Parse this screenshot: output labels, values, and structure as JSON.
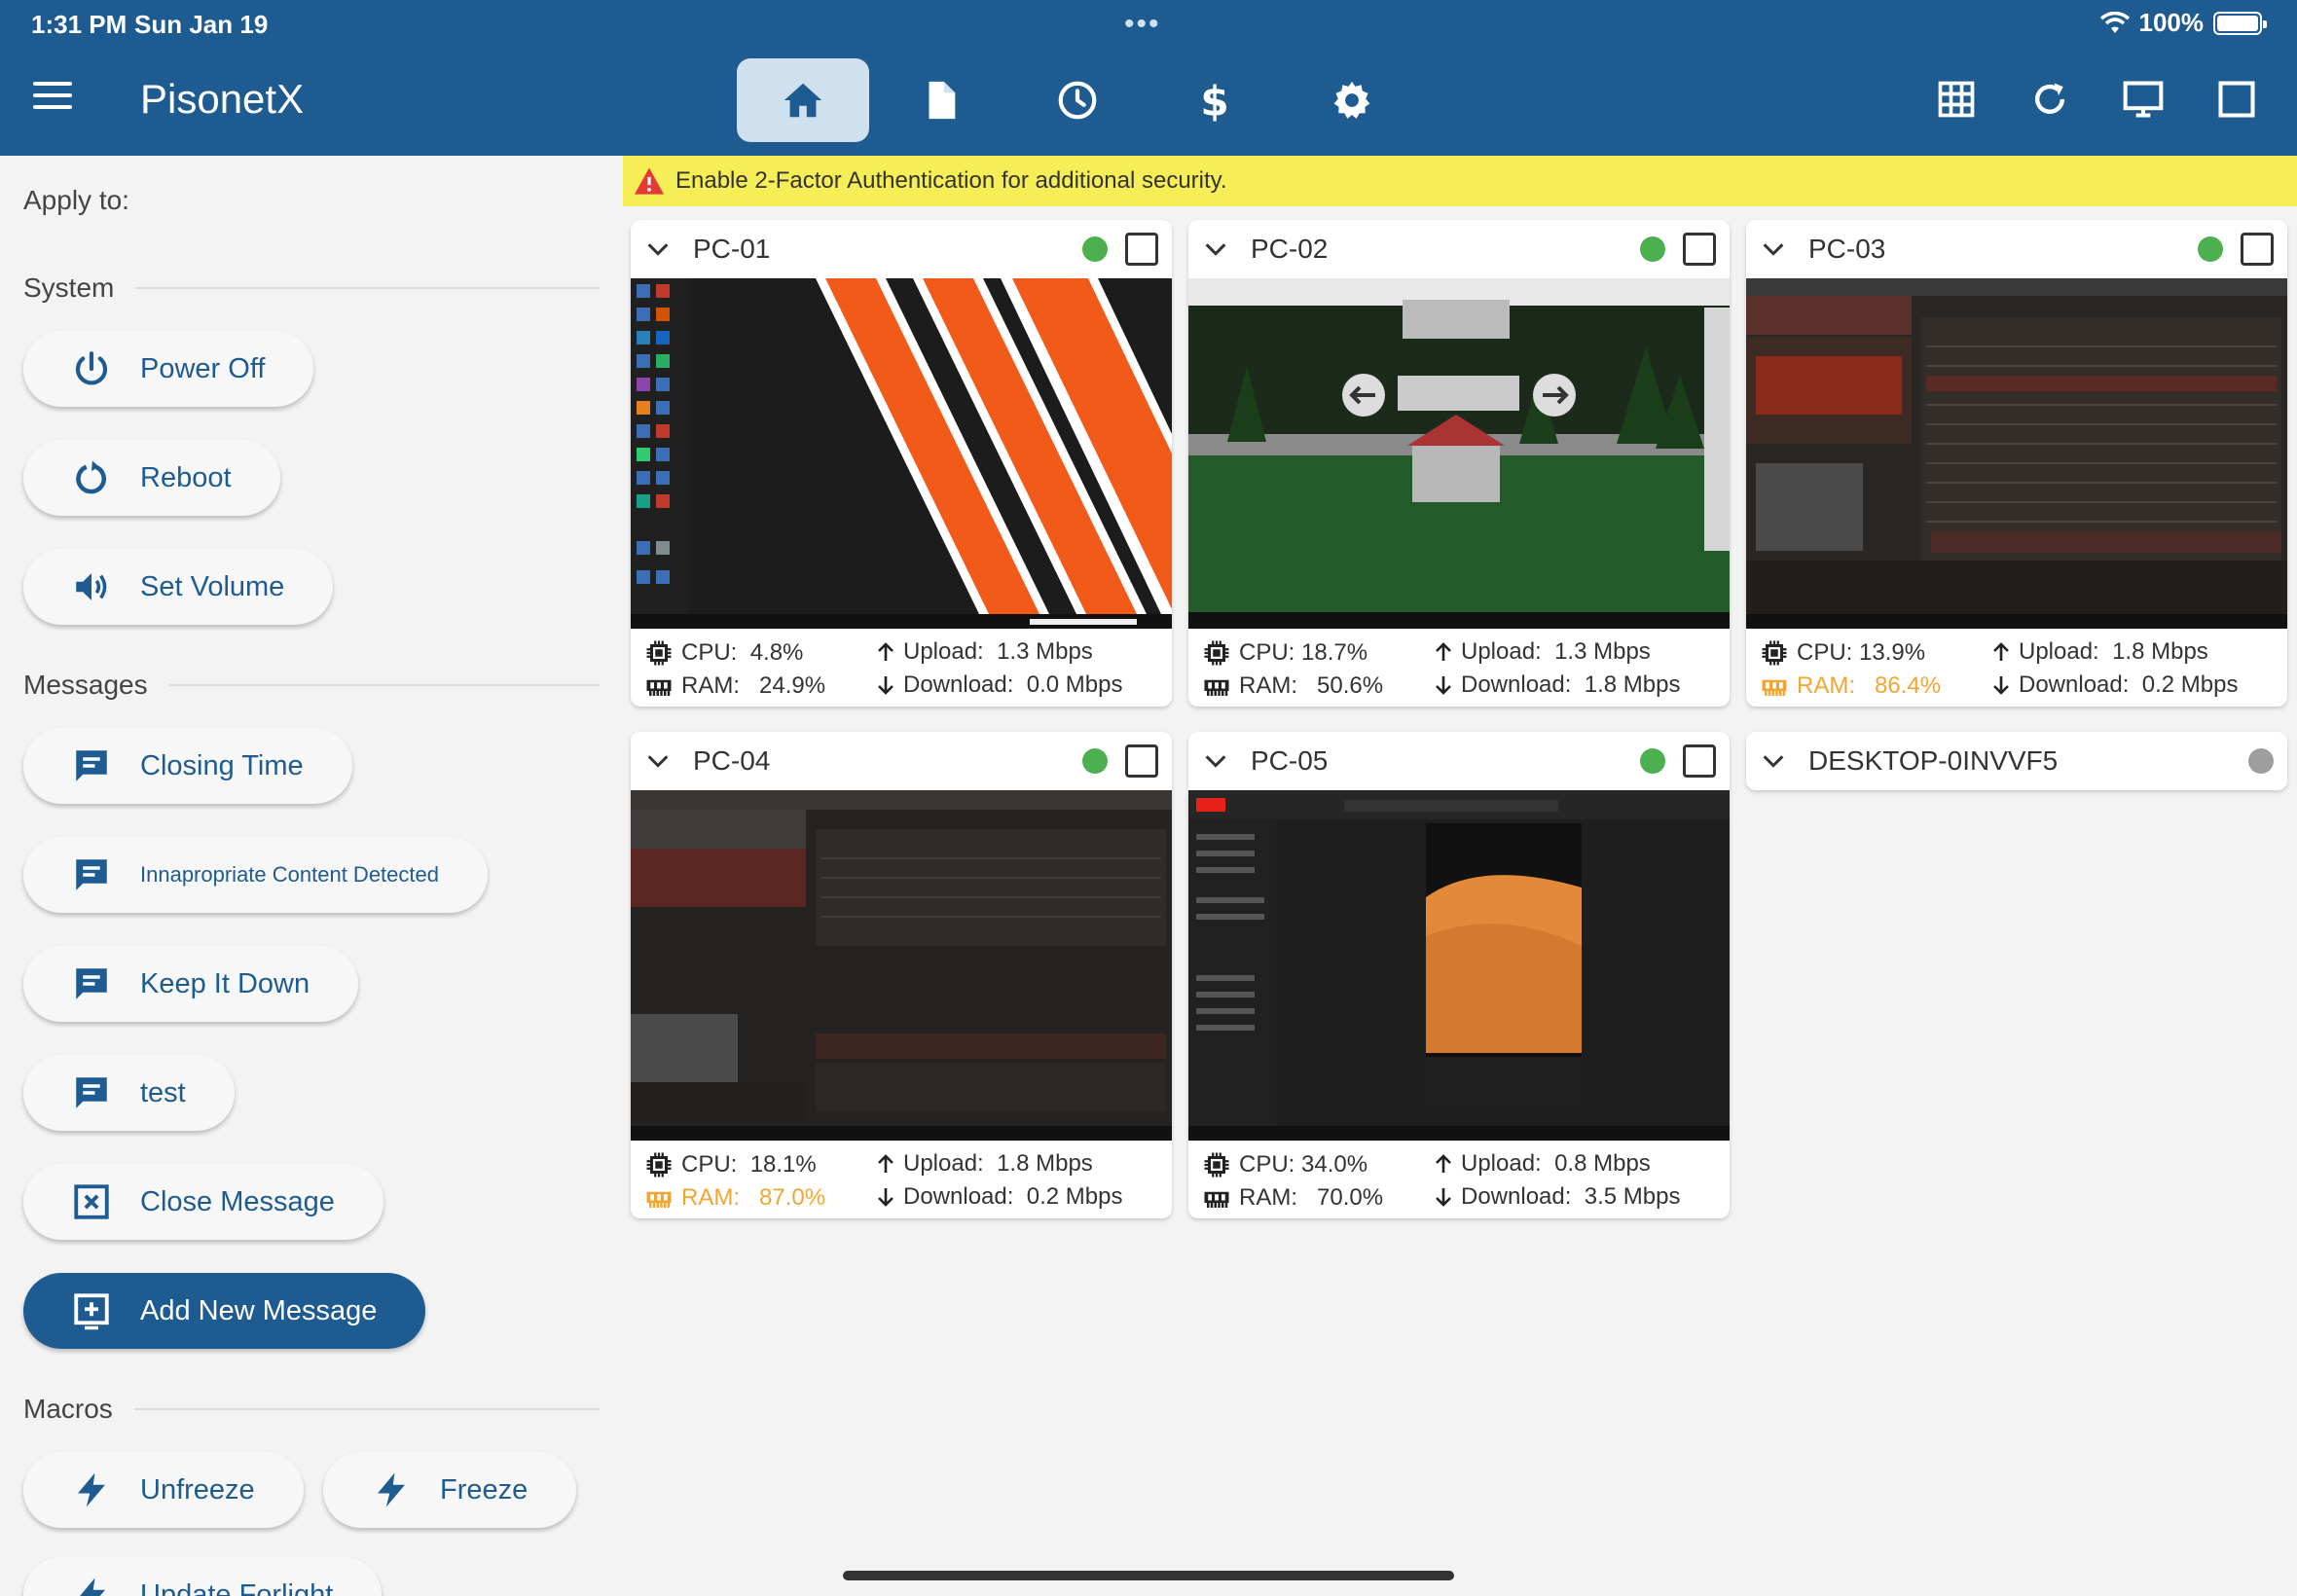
{
  "status_bar": {
    "time": "1:31 PM",
    "date": "Sun Jan 19",
    "dots": "•••",
    "battery": "100%"
  },
  "header": {
    "title": "PisonetX",
    "nav_tabs": [
      "home",
      "document",
      "history",
      "billing",
      "settings"
    ],
    "tools": [
      "grid-icon",
      "refresh-icon",
      "monitor-icon",
      "square-icon"
    ]
  },
  "sidebar": {
    "apply_to": "Apply to:",
    "system": {
      "title": "System",
      "buttons": [
        "Power Off",
        "Reboot",
        "Set Volume"
      ]
    },
    "messages": {
      "title": "Messages",
      "buttons": [
        "Closing Time",
        "Innapropriate Content Detected",
        "Keep It Down",
        "test",
        "Close Message"
      ],
      "add_button": "Add New Message"
    },
    "macros": {
      "title": "Macros",
      "buttons": [
        "Unfreeze",
        "Freeze",
        "Update Forlight"
      ]
    }
  },
  "banner": {
    "text": "Enable 2-Factor Authentication for additional security."
  },
  "labels": {
    "cpu": "CPU:",
    "ram": "RAM:",
    "upload": "Upload:",
    "download": "Download:"
  },
  "pcs": [
    {
      "name": "PC-01",
      "status": "online",
      "cpu": "4.8%",
      "ram": "24.9%",
      "ram_warn": false,
      "upload": "1.3 Mbps",
      "download": "0.0 Mbps"
    },
    {
      "name": "PC-02",
      "status": "online",
      "cpu": "18.7%",
      "ram": "50.6%",
      "ram_warn": false,
      "upload": "1.3 Mbps",
      "download": "1.8 Mbps"
    },
    {
      "name": "PC-03",
      "status": "online",
      "cpu": "13.9%",
      "ram": "86.4%",
      "ram_warn": true,
      "upload": "1.8 Mbps",
      "download": "0.2 Mbps"
    },
    {
      "name": "PC-04",
      "status": "online",
      "cpu": "18.1%",
      "ram": "87.0%",
      "ram_warn": true,
      "upload": "1.8 Mbps",
      "download": "0.2 Mbps"
    },
    {
      "name": "PC-05",
      "status": "online",
      "cpu": "34.0%",
      "ram": "70.0%",
      "ram_warn": false,
      "upload": "0.8 Mbps",
      "download": "3.5 Mbps"
    },
    {
      "name": "DESKTOP-0INVVF5",
      "status": "offline"
    }
  ],
  "colors": {
    "primary": "#1e5b90",
    "online": "#4caf50",
    "offline": "#9e9e9e",
    "banner": "#f6ee56",
    "warning": "#f2a632"
  }
}
